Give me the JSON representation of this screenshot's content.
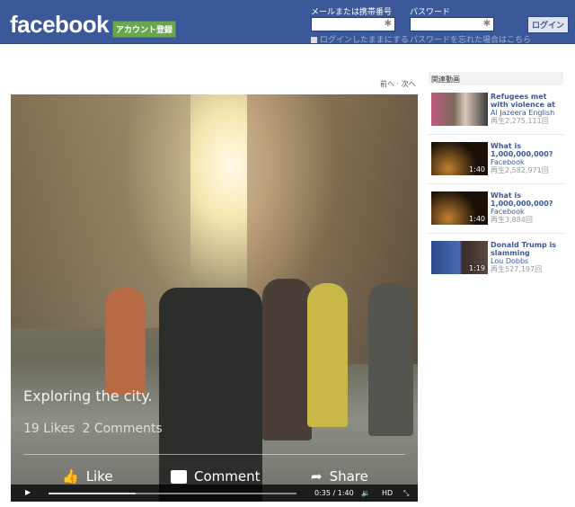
{
  "header": {
    "logo": "facebook",
    "signup": "アカウント登録",
    "email_label": "メールまたは携帯番号",
    "password_label": "パスワード",
    "email_value": "",
    "password_value": "",
    "remember": "ログインしたままにする",
    "forgot": "パスワードを忘れた場合はこちら",
    "login": "ログイン"
  },
  "pager": {
    "prev": "前へ",
    "sep": "·",
    "next": "次へ"
  },
  "video": {
    "caption": "Exploring the city.",
    "likes": "19 Likes",
    "comments": "2 Comments",
    "like": "Like",
    "comment": "Comment",
    "share": "Share",
    "time": "0:35 / 1:40",
    "hd": "HD",
    "progress": 0.35
  },
  "sidebar": {
    "heading": "関連動画",
    "items": [
      {
        "title": "Refugees met with violence at",
        "author": "Al Jazeera English",
        "views": "再生2,275,111回",
        "duration": ""
      },
      {
        "title": "What is 1,000,000,000?",
        "author": "Facebook",
        "views": "再生2,582,971回",
        "duration": "1:40"
      },
      {
        "title": "What is 1,000,000,000?",
        "author": "Facebook",
        "views": "再生3,884回",
        "duration": "1:40"
      },
      {
        "title": "Donald Trump is slamming",
        "author": "Lou Dobbs",
        "views": "再生527,197回",
        "duration": "1:19"
      }
    ]
  }
}
